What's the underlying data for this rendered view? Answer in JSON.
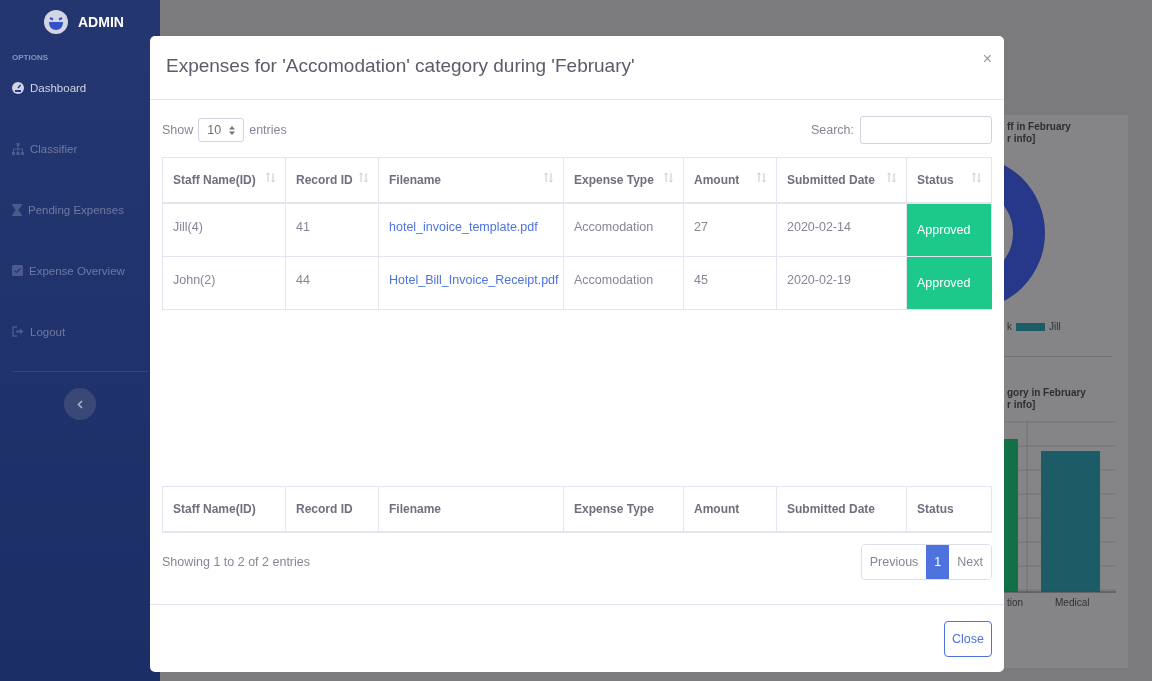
{
  "sidebar": {
    "brand": "ADMIN",
    "section": "OPTIONS",
    "items": [
      {
        "label": "Dashboard",
        "selected": true
      },
      {
        "label": "Classifier",
        "selected": false
      },
      {
        "label": "Pending Expenses",
        "selected": false
      },
      {
        "label": "Expense Overview",
        "selected": false
      },
      {
        "label": "Logout",
        "selected": false
      }
    ]
  },
  "dashboard_card": {
    "donut_title": [
      "ff in February",
      "r info]"
    ],
    "legend": [
      {
        "label": "k"
      },
      {
        "label": "Jill",
        "color": "#1b5c66"
      }
    ],
    "bar_title": [
      "gory in February",
      "r info]"
    ],
    "bar_labels": [
      "tion",
      "Medical"
    ]
  },
  "modal": {
    "title": "Expenses for 'Accomodation' category during 'February'",
    "close_icon": "×",
    "length_menu": {
      "prefix": "Show",
      "value": "10",
      "suffix": "entries"
    },
    "search": {
      "label": "Search:"
    },
    "columns": [
      "Staff Name(ID)",
      "Record ID",
      "Filename",
      "Expense Type",
      "Amount",
      "Submitted Date",
      "Status"
    ],
    "rows": [
      {
        "staff": "Jill(4)",
        "record_id": "41",
        "filename": "hotel_invoice_template.pdf",
        "expense_type": "Accomodation",
        "amount": "27",
        "submitted_date": "2020-02-14",
        "status": "Approved"
      },
      {
        "staff": "John(2)",
        "record_id": "44",
        "filename": "Hotel_Bill_Invoice_Receipt.pdf",
        "expense_type": "Accomodation",
        "amount": "45",
        "submitted_date": "2020-02-19",
        "status": "Approved"
      }
    ],
    "footer_columns": [
      "Staff Name(ID)",
      "Record ID",
      "Filename",
      "Expense Type",
      "Amount",
      "Submitted Date",
      "Status"
    ],
    "info": "Showing 1 to 2 of 2 entries",
    "pagination": {
      "previous": "Previous",
      "pages": [
        {
          "label": "1",
          "selected": true
        }
      ],
      "next": "Next"
    },
    "close_button": "Close"
  }
}
